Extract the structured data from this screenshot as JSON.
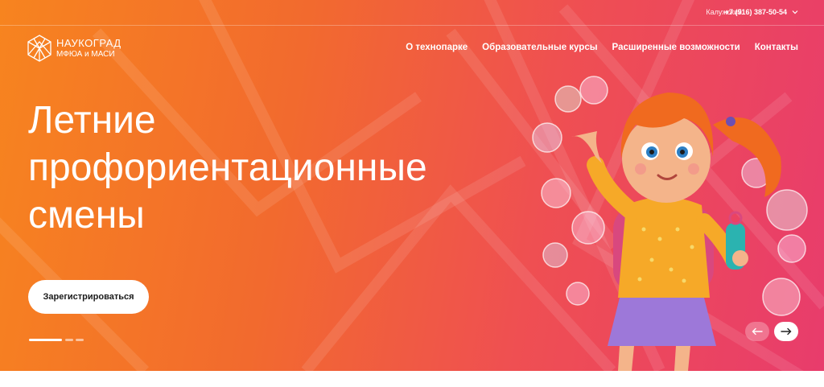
{
  "topbar": {
    "region": "Калужский",
    "phone": "+7 (916) 387-50-54"
  },
  "logo": {
    "title": "НАУКОГРАД",
    "subtitle": "МФЮА и МАСИ"
  },
  "nav": {
    "items": [
      {
        "label": "О технопарке"
      },
      {
        "label": "Образовательные курсы"
      },
      {
        "label": "Расширенные возможности"
      },
      {
        "label": "Контакты"
      }
    ]
  },
  "hero": {
    "headline_lines": [
      "Летние",
      "профориентационные",
      "смены"
    ],
    "cta_label": "Зарегистрироваться",
    "slides_total": 3,
    "active_slide": 1
  },
  "colors": {
    "gradient_start": "#f7841f",
    "gradient_end": "#e83c6c",
    "accent_white": "#ffffff"
  },
  "icons": {
    "logo": "hexagon-logo-icon",
    "region_dropdown": "chevron-down-icon",
    "prev": "arrow-left-icon",
    "next": "arrow-right-icon"
  }
}
